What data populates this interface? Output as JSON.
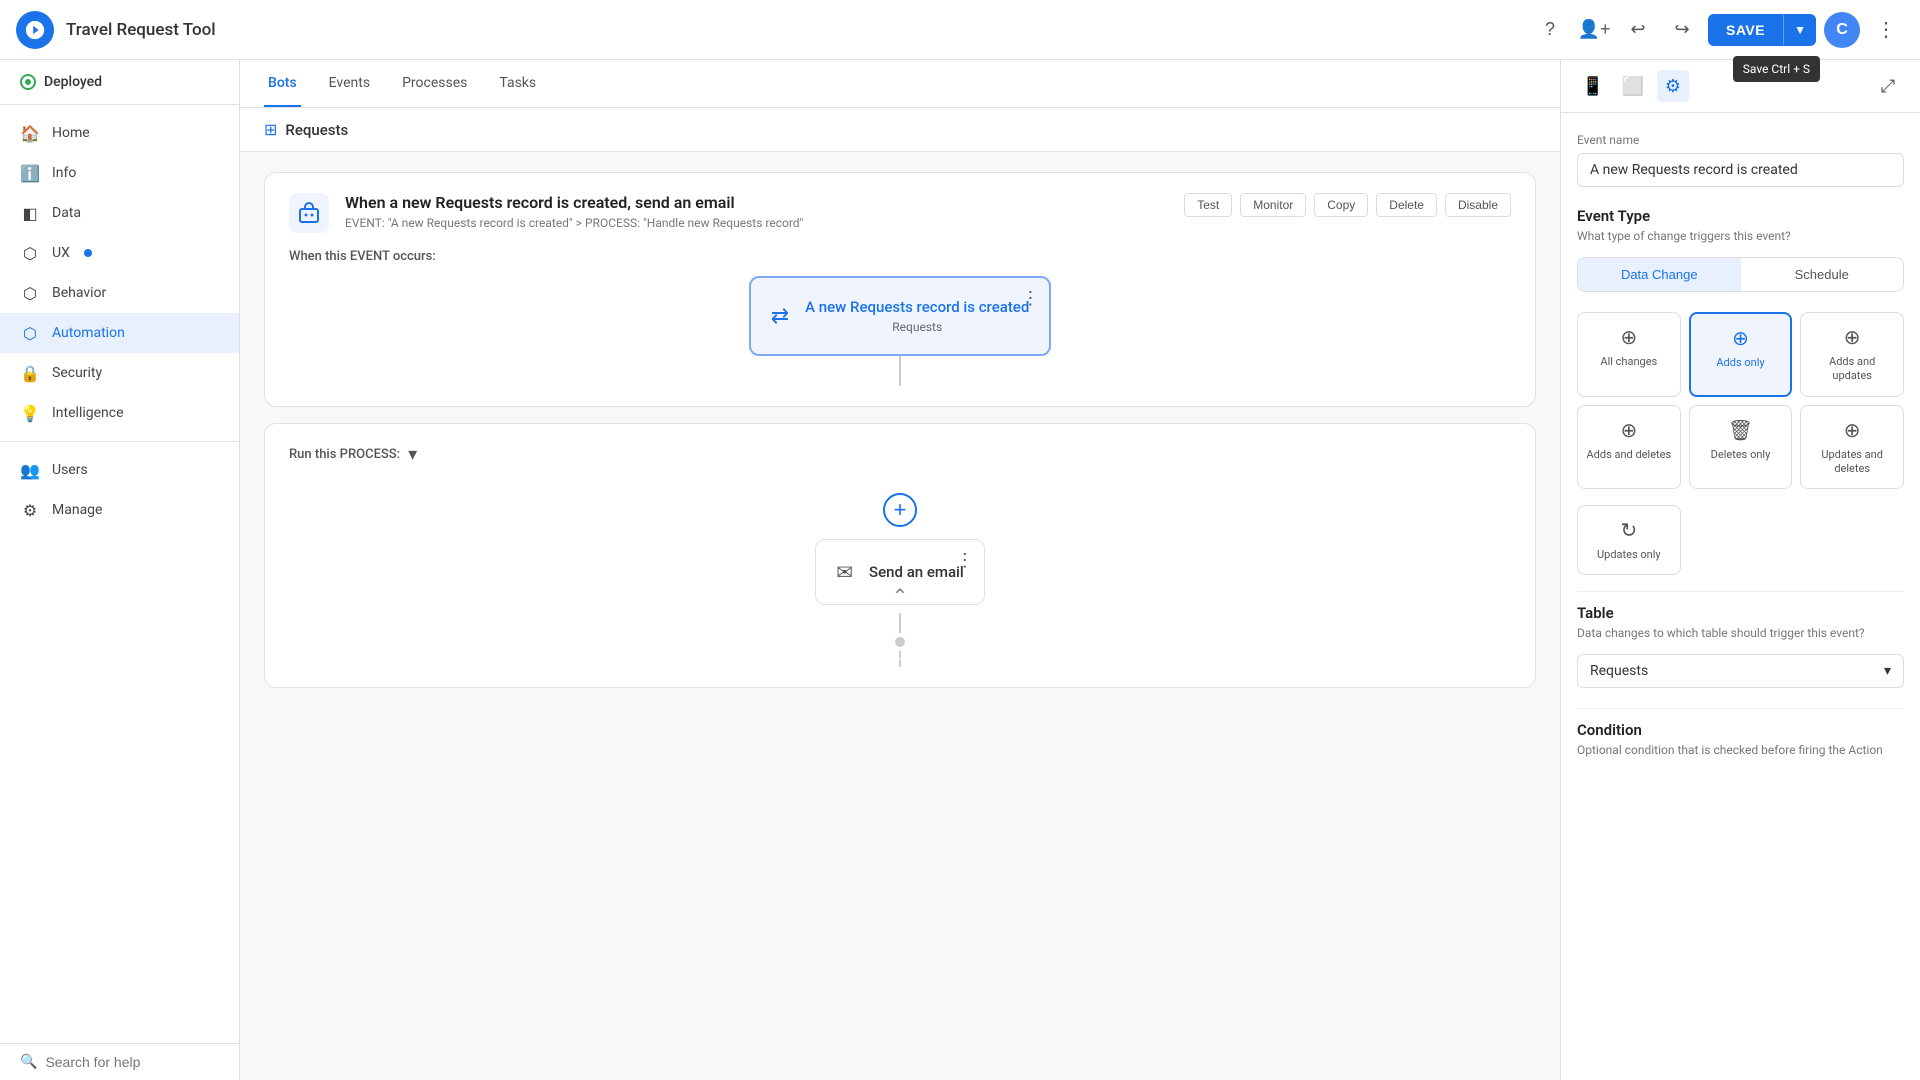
{
  "topbar": {
    "title": "Travel Request Tool",
    "save_label": "SAVE",
    "save_tooltip": "Save Ctrl + S",
    "avatar_label": "C"
  },
  "sidebar": {
    "deployed_label": "Deployed",
    "nav_items": [
      {
        "id": "home",
        "label": "Home",
        "icon": "⌂",
        "active": false
      },
      {
        "id": "info",
        "label": "Info",
        "icon": "ℹ",
        "active": false
      },
      {
        "id": "data",
        "label": "Data",
        "icon": "◫",
        "active": false
      },
      {
        "id": "ux",
        "label": "UX",
        "icon": "⬡",
        "active": false,
        "badge": true
      },
      {
        "id": "behavior",
        "label": "Behavior",
        "icon": "⬡",
        "active": false
      },
      {
        "id": "automation",
        "label": "Automation",
        "icon": "⬡",
        "active": true
      },
      {
        "id": "security",
        "label": "Security",
        "icon": "⬡",
        "active": false
      },
      {
        "id": "intelligence",
        "label": "Intelligence",
        "icon": "⬡",
        "active": false
      }
    ],
    "nav_users": [
      {
        "id": "users",
        "label": "Users",
        "icon": "👤"
      },
      {
        "id": "manage",
        "label": "Manage",
        "icon": "⚙"
      }
    ],
    "search_placeholder": "Search for help"
  },
  "tabs": [
    {
      "label": "Bots",
      "active": true
    },
    {
      "label": "Events",
      "active": false
    },
    {
      "label": "Processes",
      "active": false
    },
    {
      "label": "Tasks",
      "active": false
    }
  ],
  "breadcrumb": "Requests",
  "bot": {
    "title": "When a new Requests record is created, send an email",
    "event_desc": "EVENT: \"A new Requests record is created\" > PROCESS: \"Handle new Requests record\"",
    "actions": [
      "Test",
      "Monitor",
      "Copy",
      "Delete",
      "Disable"
    ],
    "when_event_label": "When this EVENT occurs:",
    "trigger_text": "A new Requests record is created",
    "trigger_sub": "Requests",
    "process_label": "Run this PROCESS:",
    "email_action_label": "Send an email"
  },
  "right_panel": {
    "event_name_label": "Event name",
    "event_name_value": "A new Requests record is created",
    "event_type_section": "Event Type",
    "event_type_sub": "What type of change triggers this event?",
    "event_type_tabs": [
      {
        "label": "Data Change",
        "active": true
      },
      {
        "label": "Schedule",
        "active": false
      }
    ],
    "event_options": [
      {
        "id": "all_changes",
        "label": "All changes",
        "icon": "⊕",
        "active": false
      },
      {
        "id": "adds_only",
        "label": "Adds only",
        "icon": "⊕",
        "active": true
      },
      {
        "id": "adds_updates",
        "label": "Adds and updates",
        "icon": "⊕",
        "active": false
      },
      {
        "id": "adds_deletes",
        "label": "Adds and deletes",
        "icon": "⊕",
        "active": false
      },
      {
        "id": "deletes_only",
        "label": "Deletes only",
        "icon": "🗑",
        "active": false
      },
      {
        "id": "updates_deletes",
        "label": "Updates and deletes",
        "icon": "⊕",
        "active": false
      },
      {
        "id": "updates_only",
        "label": "Updates only",
        "icon": "↻",
        "active": false
      }
    ],
    "table_section": "Table",
    "table_sub": "Data changes to which table should trigger this event?",
    "table_value": "Requests",
    "condition_section": "Condition",
    "condition_sub": "Optional condition that is checked before firing the Action"
  }
}
